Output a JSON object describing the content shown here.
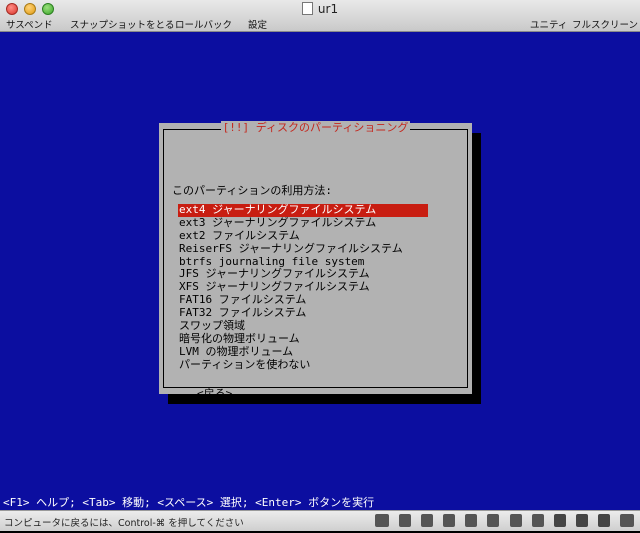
{
  "window": {
    "title": "ur1",
    "toolbar": {
      "suspend": "サスペンド",
      "snapshot": "スナップショットをとる",
      "rollback": "ロールバック",
      "settings": "設定",
      "unity": "ユニティ",
      "fullscreen": "フルスクリーン"
    }
  },
  "dialog": {
    "title": "[!!] ディスクのパーティショニング",
    "prompt": "このパーティションの利用方法:",
    "options": [
      "ext4 ジャーナリングファイルシステム",
      "ext3 ジャーナリングファイルシステム",
      "ext2 ファイルシステム",
      "ReiserFS ジャーナリングファイルシステム",
      "btrfs journaling file system",
      "JFS ジャーナリングファイルシステム",
      "XFS ジャーナリングファイルシステム",
      "FAT16 ファイルシステム",
      "FAT32 ファイルシステム",
      "スワップ領域",
      "暗号化の物理ボリューム",
      "LVM の物理ボリューム",
      "パーティションを使わない"
    ],
    "selected_index": 0,
    "back": "<戻る>"
  },
  "help_line": "<F1> ヘルプ; <Tab> 移動; <スペース> 選択; <Enter> ボタンを実行",
  "status": {
    "text": "コンピュータに戻るには、Control-⌘ を押してください"
  },
  "colors": {
    "screen_bg": "#0c0ea0",
    "dialog_bg": "#b2b2b2",
    "highlight": "#c81d11",
    "title_text": "#c4281e"
  }
}
